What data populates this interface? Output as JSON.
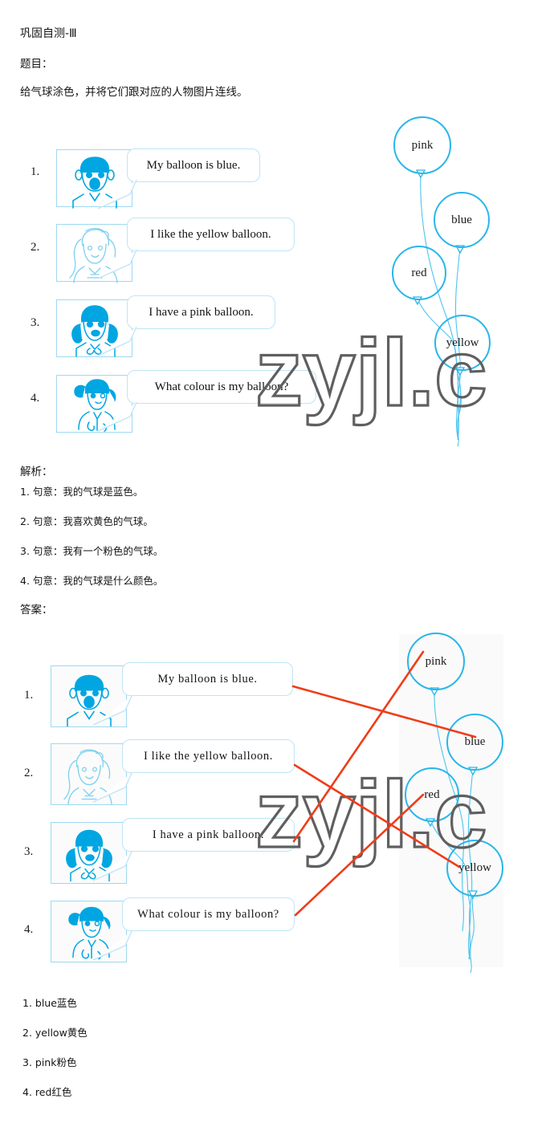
{
  "header": {
    "title": "巩固自测-Ⅲ",
    "question_label": "题目：",
    "instruction": "给气球涂色，并将它们跟对应的人物图片连线。"
  },
  "exercise": {
    "items": [
      {
        "num": "1.",
        "sentence": "My balloon is blue.",
        "face": "boy-curly-hair-face"
      },
      {
        "num": "2.",
        "sentence": "I like the yellow balloon.",
        "face": "girl-long-wavy-hair-face"
      },
      {
        "num": "3.",
        "sentence": "I have a pink balloon.",
        "face": "girl-pigtails-face"
      },
      {
        "num": "4.",
        "sentence": "What colour is my balloon?",
        "face": "girl-side-ponytail-face"
      }
    ],
    "balloons": [
      {
        "label": "pink"
      },
      {
        "label": "blue"
      },
      {
        "label": "red"
      },
      {
        "label": "yellow"
      }
    ]
  },
  "analysis": {
    "label": "解析：",
    "lines": [
      "1. 句意：我的气球是蓝色。",
      "2. 句意：我喜欢黄色的气球。",
      "3. 句意：我有一个粉色的气球。",
      "4. 句意：我的气球是什么颜色。"
    ]
  },
  "answer": {
    "label": "答案：",
    "items": [
      {
        "num": "1.",
        "sentence": "My balloon is blue.",
        "face": "boy-curly-hair-face"
      },
      {
        "num": "2.",
        "sentence": "I like the yellow balloon.",
        "face": "girl-long-wavy-hair-face"
      },
      {
        "num": "3.",
        "sentence": "I have a pink balloon.",
        "face": "girl-pigtails-face"
      },
      {
        "num": "4.",
        "sentence": "What colour is my balloon?",
        "face": "girl-side-ponytail-face"
      }
    ],
    "balloons": [
      {
        "label": "pink"
      },
      {
        "label": "blue"
      },
      {
        "label": "red"
      },
      {
        "label": "yellow"
      }
    ],
    "matches": [
      {
        "from": "1.",
        "to": "blue"
      },
      {
        "from": "2.",
        "to": "yellow"
      },
      {
        "from": "3.",
        "to": "pink"
      },
      {
        "from": "4.",
        "to": "red"
      }
    ],
    "list": [
      "1. blue蓝色",
      "2. yellow黄色",
      "3. pink粉色",
      "4. red红色"
    ]
  },
  "watermark": {
    "text": "zyjl.c"
  },
  "colors": {
    "line": "#f03c18",
    "balloon_stroke": "#29b6ea",
    "character": "#00a6e2",
    "bubble_border": "#bfe4f6",
    "watermark": "#5f5f5f"
  }
}
